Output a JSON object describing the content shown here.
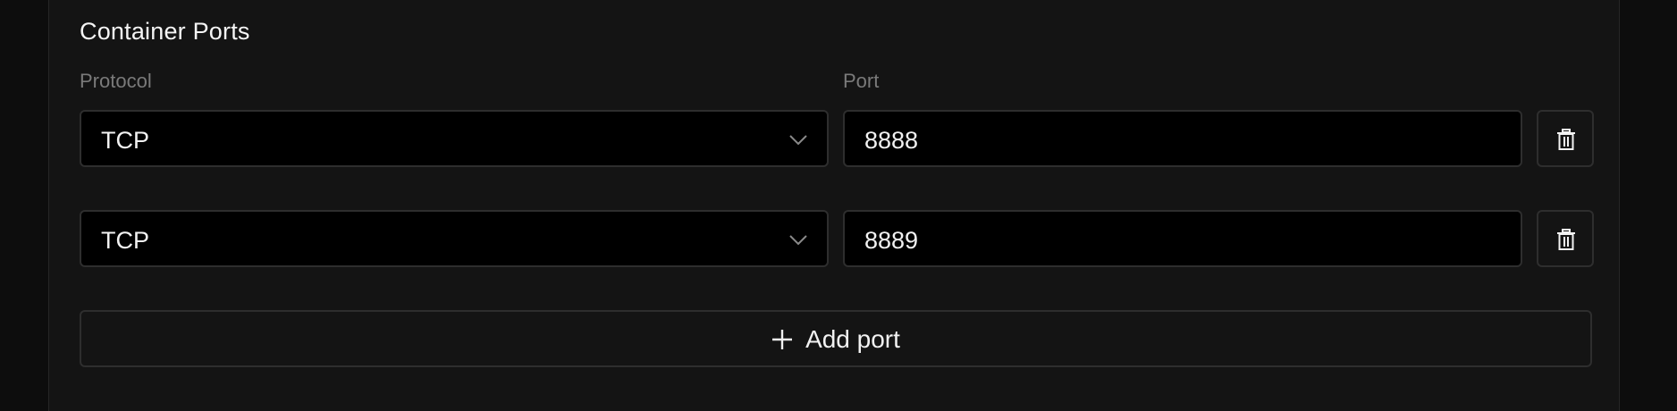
{
  "section": {
    "title": "Container Ports"
  },
  "columns": {
    "protocol_label": "Protocol",
    "port_label": "Port"
  },
  "ports": [
    {
      "protocol": "TCP",
      "port": "8888"
    },
    {
      "protocol": "TCP",
      "port": "8889"
    }
  ],
  "add_button": {
    "label": "Add port"
  },
  "icons": {
    "select_chevron": "chevron-down-icon",
    "delete": "trash-icon",
    "add": "plus-icon"
  },
  "colors": {
    "background": "#0d0d0d",
    "panel": "#141414",
    "field": "#000000",
    "border": "#2e2e2e",
    "label_muted": "#7a7a7a",
    "text": "#f2f2f2"
  }
}
